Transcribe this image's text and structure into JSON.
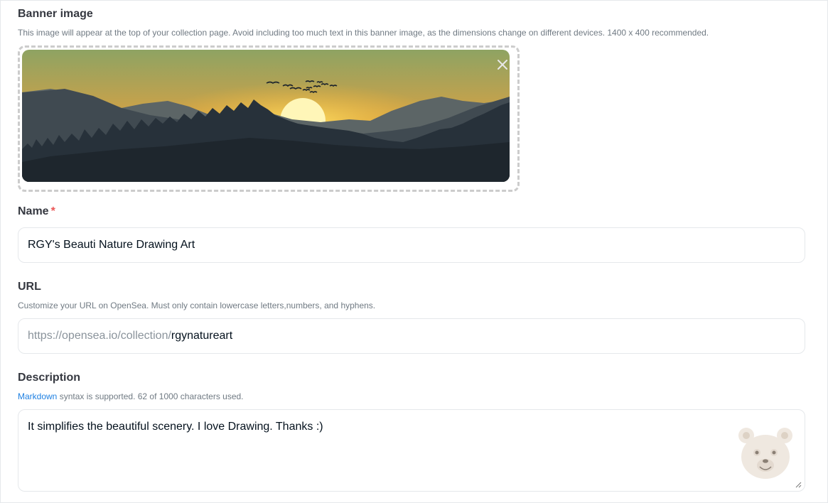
{
  "banner": {
    "title": "Banner image",
    "hint": "This image will appear at the top of your collection page. Avoid including too much text in this banner image, as the dimensions change on different devices. 1400 x 400 recommended.",
    "close_icon": "close-icon"
  },
  "name": {
    "title": "Name",
    "required_mark": "*",
    "value": "RGY's Beauti Nature Drawing Art"
  },
  "url": {
    "title": "URL",
    "hint": "Customize your URL on OpenSea. Must only contain lowercase letters,numbers, and hyphens.",
    "prefix": "https://opensea.io/collection/",
    "value": "rgynatureart"
  },
  "description": {
    "title": "Description",
    "hint_link": "Markdown",
    "hint_rest": " syntax is supported. 62 of 1000 characters used.",
    "value": "It simplifies the beautiful scenery. I love Drawing. Thanks :)"
  },
  "colors": {
    "accent_link": "#2081e2",
    "required": "#eb5757",
    "border": "#e5e8eb"
  }
}
